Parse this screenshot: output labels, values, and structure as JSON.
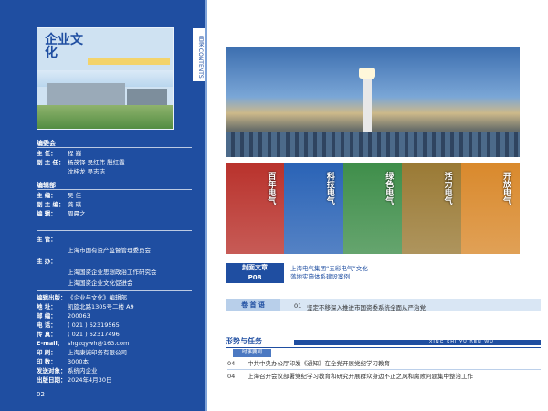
{
  "cover": {
    "title": "企业文化"
  },
  "editorial_board": {
    "heading": "编委会",
    "rows": [
      {
        "key": "主  任：",
        "value": "程 巍"
      },
      {
        "key": "副 主 任：",
        "value": "杨茂铎  吴红伟  殷红霞"
      },
      {
        "key": "",
        "value": "沈桂龙  吴志洁"
      }
    ]
  },
  "editorial_dept": {
    "heading": "编辑部",
    "rows": [
      {
        "key": "主  编：",
        "value": "吴 佳"
      },
      {
        "key": "副 主 编：",
        "value": "龚 琪"
      },
      {
        "key": "编  辑：",
        "value": "周晨之"
      }
    ]
  },
  "sponsors": {
    "rows": [
      {
        "key": "主  管：",
        "value": ""
      },
      {
        "key": "",
        "value": "上海市国有资产监督管理委员会"
      },
      {
        "key": "主  办：",
        "value": ""
      },
      {
        "key": "",
        "value": "上海国资企业思想政治工作研究会"
      },
      {
        "key": "",
        "value": "上海国资企业文化促进会"
      }
    ]
  },
  "publish_info": {
    "rows": [
      {
        "key": "编辑出版：",
        "value": "《企业与文化》编辑部"
      },
      {
        "key": "地  址：",
        "value": "凯旋北路1305号二楼 A9"
      },
      {
        "key": "邮  编：",
        "value": "200063"
      },
      {
        "key": "电  话：",
        "value": "( 021 ) 62319565"
      },
      {
        "key": "传  真：",
        "value": "( 021 ) 62317496"
      },
      {
        "key": "E-mail：",
        "value": "shgzqywh@163.com"
      },
      {
        "key": "印  刷：",
        "value": "上海康诚印务有限公司"
      },
      {
        "key": "印  数：",
        "value": "3000本"
      },
      {
        "key": "发送对象：",
        "value": "系统内企业"
      },
      {
        "key": "出版日期：",
        "value": "2024年4月30日"
      }
    ]
  },
  "page_number": "02",
  "toc_tab": "目录 CONTENTS",
  "strips": [
    {
      "label": "百年电气",
      "color": "#b9322c"
    },
    {
      "label": "科技电气",
      "color": "#2a63b6"
    },
    {
      "label": "绿色电气",
      "color": "#3f8e4a"
    },
    {
      "label": "活力电气",
      "color": "#9a7a35"
    },
    {
      "label": "开放电气",
      "color": "#d9892c"
    }
  ],
  "feature": {
    "label": "封面文章",
    "page": "P08",
    "title_line1": "上海电气集团“五彩电气”文化",
    "title_line2": "落地实施体系建设案例"
  },
  "juanshou": {
    "label": "卷 首 语",
    "page": "01",
    "title": "坚定不移深入推进市国资委系统全面从严治党"
  },
  "section": {
    "title": "形势与任务",
    "pinyin": "XING SHI YU REN WU",
    "sub_tag": "时事要闻",
    "items": [
      {
        "page": "04",
        "title": "中共中央办公厅印发《通知》在全党开展党纪学习教育"
      },
      {
        "page": "04",
        "title": "上海召开会议部署党纪学习教育和研究开展群众身边不正之风和腐败问题集中整治工作"
      }
    ]
  }
}
